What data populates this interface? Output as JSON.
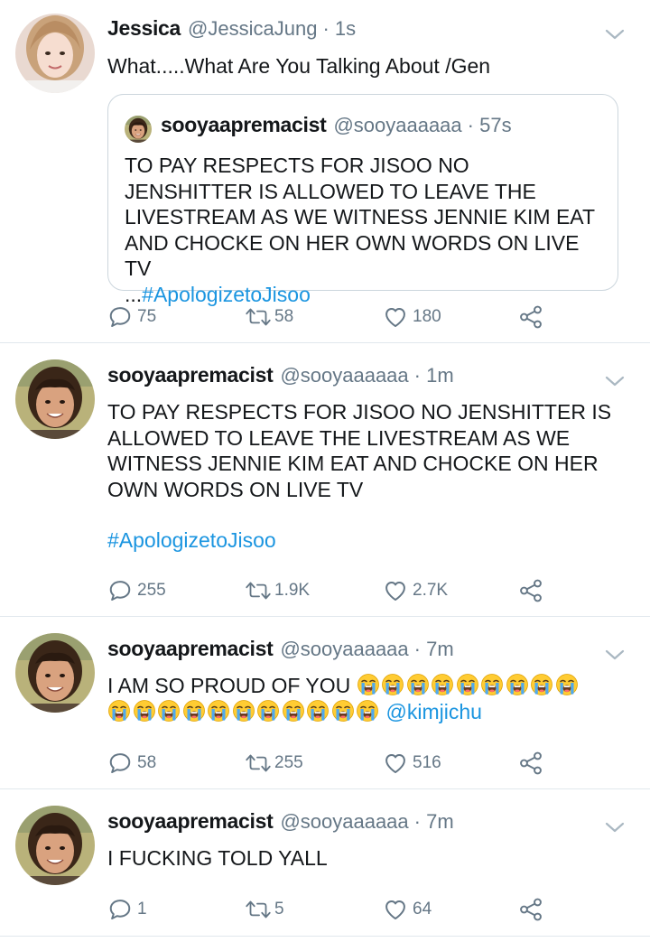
{
  "colors": {
    "link": "#1b95e0",
    "secondary": "#657786",
    "divider": "#e1e8ed"
  },
  "tweets": [
    {
      "display_name": "Jessica",
      "handle": "@JessicaJung",
      "time": "· 1s",
      "text": "What.....What Are You Talking About /Gen",
      "quoted": {
        "display_name": "sooyaapremacist",
        "handle": "@sooyaaaaaa",
        "time": "· 57s",
        "text": "TO PAY RESPECTS FOR JISOO NO JENSHITTER IS ALLOWED TO LEAVE THE LIVESTREAM AS WE WITNESS JENNIE KIM EAT AND CHOCKE ON HER OWN WORDS ON LIVE TV",
        "ellipsis": "...",
        "hashtag": "#ApologizetoJisoo"
      },
      "replies": "75",
      "retweets": "58",
      "likes": "180"
    },
    {
      "display_name": "sooyaapremacist",
      "handle": "@sooyaaaaaa",
      "time": "· 1m",
      "text": "TO PAY RESPECTS FOR JISOO NO JENSHITTER IS ALLOWED TO LEAVE THE LIVESTREAM AS WE WITNESS JENNIE KIM EAT AND CHOCKE ON HER OWN WORDS ON LIVE TV",
      "hashtag": "#ApologizetoJisoo",
      "replies": "255",
      "retweets": "1.9K",
      "likes": "2.7K"
    },
    {
      "display_name": "sooyaapremacist",
      "handle": "@sooyaaaaaa",
      "time": "· 7m",
      "text": "I AM SO PROUD OF YOU",
      "emoji_count": 20,
      "mention": "@kimjichu",
      "replies": "58",
      "retweets": "255",
      "likes": "516"
    },
    {
      "display_name": "sooyaapremacist",
      "handle": "@sooyaaaaaa",
      "time": "· 7m",
      "text": "I FUCKING TOLD YALL",
      "replies": "1",
      "retweets": "5",
      "likes": "64"
    }
  ],
  "icons": {
    "reply": "reply-icon",
    "retweet": "retweet-icon",
    "like": "heart-icon",
    "share": "share-icon",
    "menu": "chevron-down-icon",
    "emoji": "loudly-crying-face-emoji"
  }
}
